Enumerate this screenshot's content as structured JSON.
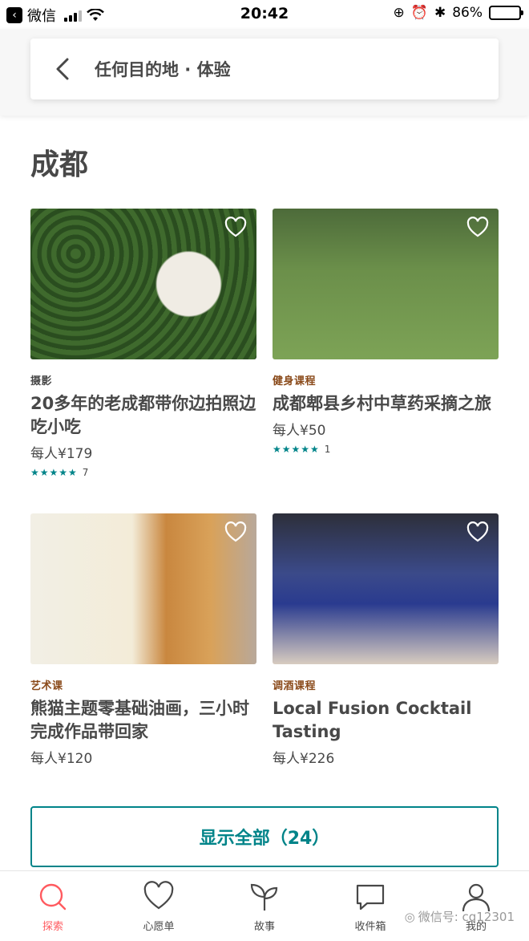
{
  "status_bar": {
    "carrier": "微信",
    "time": "20:42",
    "battery": "86%",
    "battery_level": 0.86
  },
  "search": {
    "label": "任何目的地 · 体验"
  },
  "section": {
    "city": "成都"
  },
  "cards": [
    {
      "category": "摄影",
      "category_color": "#484848",
      "title": "20多年的老成都带你边拍照边吃小吃",
      "price": "每人¥179",
      "stars": "★★★★★",
      "reviews": "7"
    },
    {
      "category": "健身课程",
      "category_color": "#8a4a1a",
      "title": "成都郫县乡村中草药采摘之旅",
      "price": "每人¥50",
      "stars": "★★★★★",
      "reviews": "1"
    },
    {
      "category": "艺术课",
      "category_color": "#8a4a1a",
      "title": "熊猫主题零基础油画，三小时完成作品带回家",
      "price": "每人¥120"
    },
    {
      "category": "调酒课程",
      "category_color": "#8a4a1a",
      "title": "Local Fusion Cocktail Tasting",
      "price": "每人¥226"
    }
  ],
  "show_all": {
    "label": "显示全部（24）"
  },
  "tabs": [
    {
      "label": "探索",
      "icon": "search-icon",
      "active": true
    },
    {
      "label": "心愿单",
      "icon": "heart-icon",
      "active": false
    },
    {
      "label": "故事",
      "icon": "sprout-icon",
      "active": false
    },
    {
      "label": "收件箱",
      "icon": "message-icon",
      "active": false
    },
    {
      "label": "我的",
      "icon": "user-icon",
      "active": false
    }
  ],
  "watermark": {
    "text": "微信号: cq12301"
  },
  "colors": {
    "accent": "#008489",
    "active_tab": "#ff5a5f",
    "text": "#484848"
  }
}
